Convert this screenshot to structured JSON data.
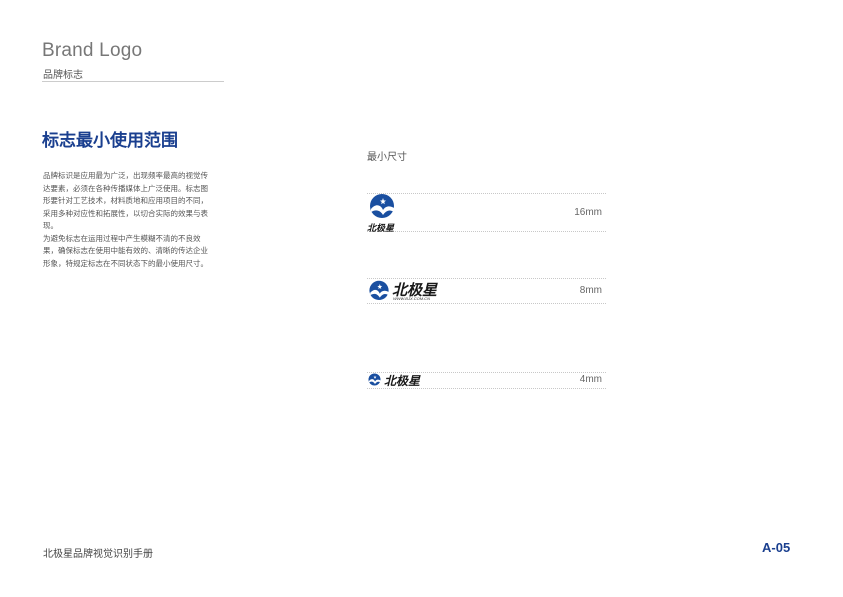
{
  "header": {
    "title": "Brand Logo",
    "subtitle": "品牌标志"
  },
  "section": {
    "title": "标志最小使用范围",
    "paragraphs": [
      "品牌标识是应用最为广泛，出现频率最高的视觉传达要素，必须在各种传播媒体上广泛使用。标志图形要针对工艺技术，材料质地和应用项目的不同，采用多种对应性和拓展性，以切合实际的效果与表现。",
      "为避免标志在运用过程中产生模糊不清的不良效果，确保标志在使用中能有效的、清晰的传达企业形象，特规定标志在不同状态下的最小使用尺寸。"
    ]
  },
  "min_size": {
    "label": "最小尺寸",
    "items": [
      {
        "size": "16mm"
      },
      {
        "size": "8mm"
      },
      {
        "size": "4mm"
      }
    ]
  },
  "logo": {
    "wordmark": "北极星",
    "url": "WWW.BJX.COM.CN",
    "brand_color": "#1a4fa0"
  },
  "footer": {
    "manual_title": "北极星品牌视觉识别手册",
    "page": "A-05"
  }
}
